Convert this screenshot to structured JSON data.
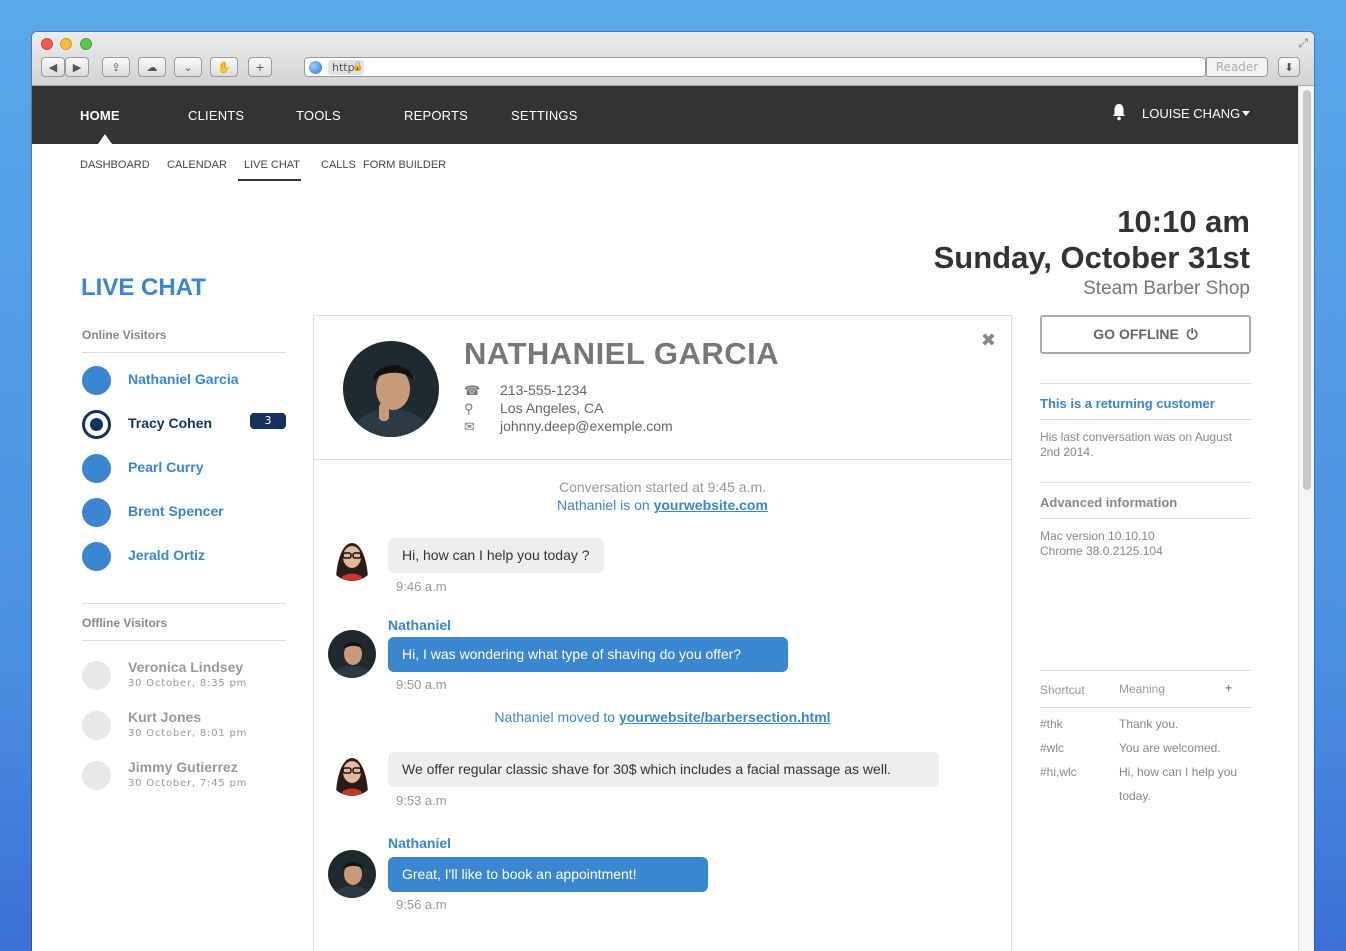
{
  "browser": {
    "url_scheme": "https",
    "reader_label": "Reader"
  },
  "nav": {
    "items": [
      "HOME",
      "CLIENTS",
      "TOOLS",
      "REPORTS",
      "SETTINGS"
    ],
    "user_name": "LOUISE CHANG"
  },
  "subnav": {
    "items": [
      "DASHBOARD",
      "CALENDAR",
      "LIVE CHAT",
      "CALLS",
      "FORM BUILDER"
    ],
    "active": "LIVE CHAT"
  },
  "header": {
    "time": "10:10 am",
    "date": "Sunday, October 31st",
    "shop": "Steam Barber Shop",
    "page_title": "LIVE CHAT"
  },
  "visitors": {
    "online_label": "Online Visitors",
    "online": [
      {
        "name": "Nathaniel Garcia"
      },
      {
        "name": "Tracy Cohen",
        "badge": "3"
      },
      {
        "name": "Pearl Curry"
      },
      {
        "name": "Brent Spencer"
      },
      {
        "name": "Jerald Ortiz"
      }
    ],
    "offline_label": "Offline Visitors",
    "offline": [
      {
        "name": "Veronica Lindsey",
        "time": "30 October, 8:35 pm"
      },
      {
        "name": "Kurt Jones",
        "time": "30 October, 8:01 pm"
      },
      {
        "name": "Jimmy Gutierrez",
        "time": "30 October, 7:45 pm"
      }
    ]
  },
  "contact": {
    "name": "NATHANIEL GARCIA",
    "phone": "213-555-1234",
    "location": "Los Angeles, CA",
    "email": "johnny.deep@exemple.com"
  },
  "conversation": {
    "started": "Conversation started at 9:45 a.m.",
    "on_prefix": "Nathaniel is on",
    "on_link": "yourwebsite.com",
    "moved_prefix": "Nathaniel moved to",
    "moved_link": "yourwebsite/barbersection.html",
    "messages": [
      {
        "from": "agent",
        "text": "Hi, how can I help you today ?",
        "time": "9:46 a.m"
      },
      {
        "from": "customer",
        "sender": "Nathaniel",
        "text": "Hi, I was wondering what type of shaving do you offer?",
        "time": "9:50 a.m"
      },
      {
        "from": "agent",
        "text": "We offer regular classic shave for 30$ which includes a facial massage as well.",
        "time": "9:53 a.m"
      },
      {
        "from": "customer",
        "sender": "Nathaniel",
        "text": "Great, I'll like to book an appointment!",
        "time": "9:56 a.m"
      }
    ]
  },
  "side": {
    "offline_button": "GO OFFLINE",
    "returning_title": "This is a returning customer",
    "returning_text": "His last conversation was on August 2nd 2014.",
    "advanced_title": "Advanced information",
    "advanced_line1": "Mac version 10.10.10",
    "advanced_line2": "Chrome 38.0.2125.104",
    "shortcut_header": "Shortcut",
    "meaning_header": "Meaning",
    "shortcuts": [
      {
        "key": "#thk",
        "meaning": "Thank you."
      },
      {
        "key": "#wlc",
        "meaning": "You are welcomed."
      },
      {
        "key": "#hi,wlc",
        "meaning": "Hi, how can I help you today."
      }
    ]
  },
  "colors": {
    "accent": "#3a86cf",
    "navy": "#13315c",
    "navbar": "#333333"
  }
}
